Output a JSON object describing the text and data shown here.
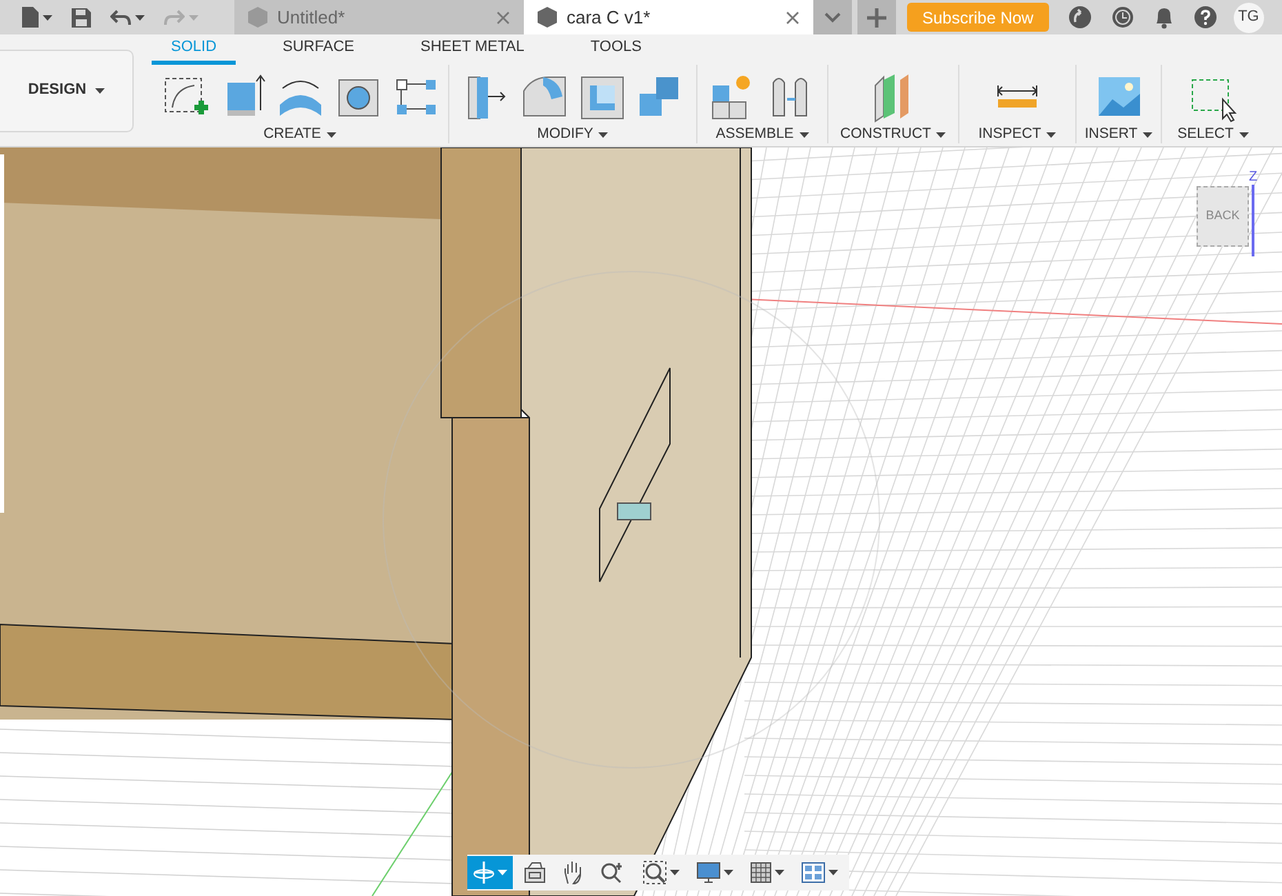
{
  "tabs": [
    {
      "label": "Untitled*",
      "selected": false
    },
    {
      "label": "cara C v1*",
      "selected": true
    }
  ],
  "subscribe_button": "Subscribe Now",
  "avatar": "TG",
  "workspace": "DESIGN",
  "ribbon_tabs": [
    {
      "label": "SOLID",
      "selected": true
    },
    {
      "label": "SURFACE",
      "selected": false
    },
    {
      "label": "SHEET METAL",
      "selected": false
    },
    {
      "label": "TOOLS",
      "selected": false
    }
  ],
  "ribbon_groups": [
    {
      "label": "CREATE"
    },
    {
      "label": "MODIFY"
    },
    {
      "label": "ASSEMBLE"
    },
    {
      "label": "CONSTRUCT"
    },
    {
      "label": "INSPECT"
    },
    {
      "label": "INSERT"
    },
    {
      "label": "SELECT"
    }
  ],
  "viewcube": {
    "face": "BACK",
    "axis": "Z"
  },
  "nav_tools": [
    {
      "kind": "orbit",
      "selected": true
    },
    {
      "kind": "look",
      "selected": false
    },
    {
      "kind": "pan",
      "selected": false
    },
    {
      "kind": "zoom",
      "selected": false
    },
    {
      "kind": "fit",
      "selected": false
    },
    {
      "kind": "display",
      "selected": false
    },
    {
      "kind": "grid",
      "selected": false
    },
    {
      "kind": "viewports",
      "selected": false
    }
  ]
}
